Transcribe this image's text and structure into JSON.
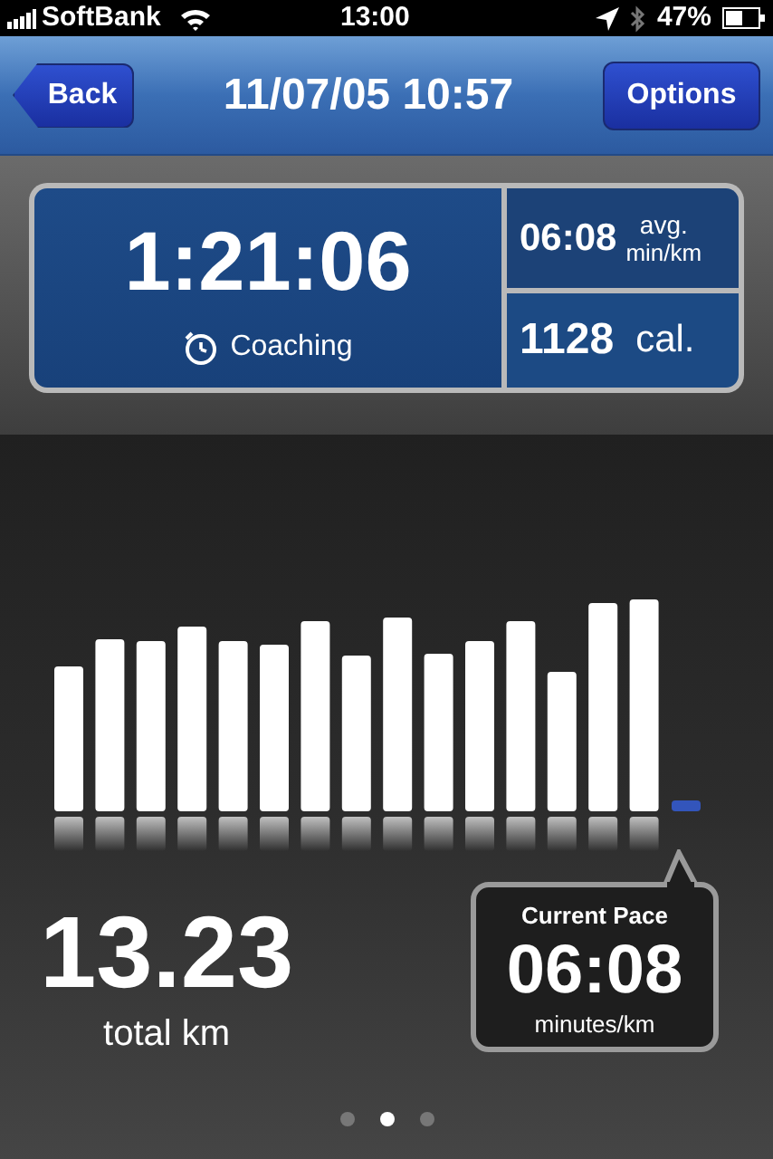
{
  "status_bar": {
    "carrier": "SoftBank",
    "time": "13:00",
    "battery": "47%"
  },
  "nav_bar": {
    "back": "Back",
    "title": "11/07/05 10:57",
    "options": "Options"
  },
  "summary": {
    "duration": "1:21:06",
    "coaching": "Coaching",
    "avg_pace": "06:08",
    "avg_label": "avg.",
    "avg_unit": "min/km",
    "calories": "1128",
    "calories_unit": "cal."
  },
  "distance": {
    "value": "13.23",
    "unit": "total km"
  },
  "current_pace": {
    "title": "Current Pace",
    "value": "06:08",
    "unit": "minutes/km"
  },
  "pages": [
    {
      "selected": false
    },
    {
      "selected": true
    },
    {
      "selected": false
    }
  ]
}
